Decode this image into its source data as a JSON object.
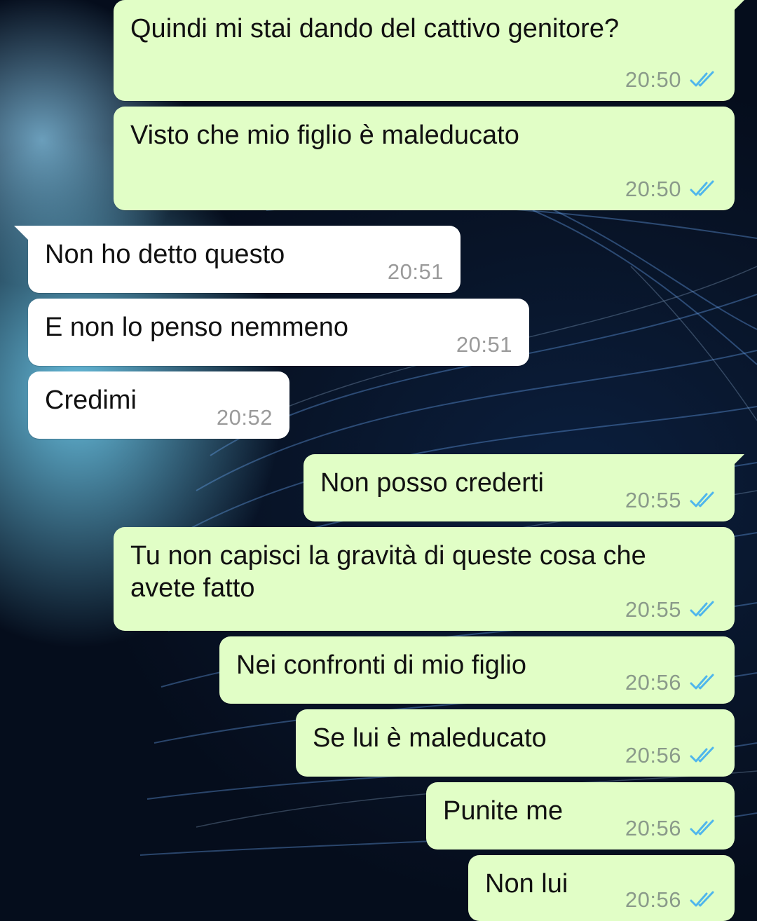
{
  "messages": [
    {
      "dir": "out",
      "text": "Quindi mi stai dando del cattivo genitore?",
      "time": "20:50",
      "ticks": "double-check-icon"
    },
    {
      "dir": "out",
      "text": "Visto che mio figlio è maleducato",
      "time": "20:50",
      "ticks": "double-check-icon"
    },
    {
      "dir": "in",
      "text": "Non ho detto questo",
      "time": "20:51"
    },
    {
      "dir": "in",
      "text": "E non lo penso nemmeno",
      "time": "20:51"
    },
    {
      "dir": "in",
      "text": "Credimi",
      "time": "20:52"
    },
    {
      "dir": "out",
      "text": "Non posso crederti",
      "time": "20:55",
      "ticks": "double-check-icon"
    },
    {
      "dir": "out",
      "text": "Tu non capisci la gravità di queste cosa che avete fatto",
      "time": "20:55",
      "ticks": "double-check-icon"
    },
    {
      "dir": "out",
      "text": "Nei confronti di mio figlio",
      "time": "20:56",
      "ticks": "double-check-icon"
    },
    {
      "dir": "out",
      "text": "Se lui è maleducato",
      "time": "20:56",
      "ticks": "double-check-icon"
    },
    {
      "dir": "out",
      "text": "Punite me",
      "time": "20:56",
      "ticks": "double-check-icon"
    },
    {
      "dir": "out",
      "text": "Non lui",
      "time": "20:56",
      "ticks": "double-check-icon"
    }
  ],
  "colors": {
    "outgoing_bubble": "#e1fec6",
    "incoming_bubble": "#ffffff",
    "read_ticks": "#4fb6ec",
    "timestamp": "#8a9a8a"
  }
}
